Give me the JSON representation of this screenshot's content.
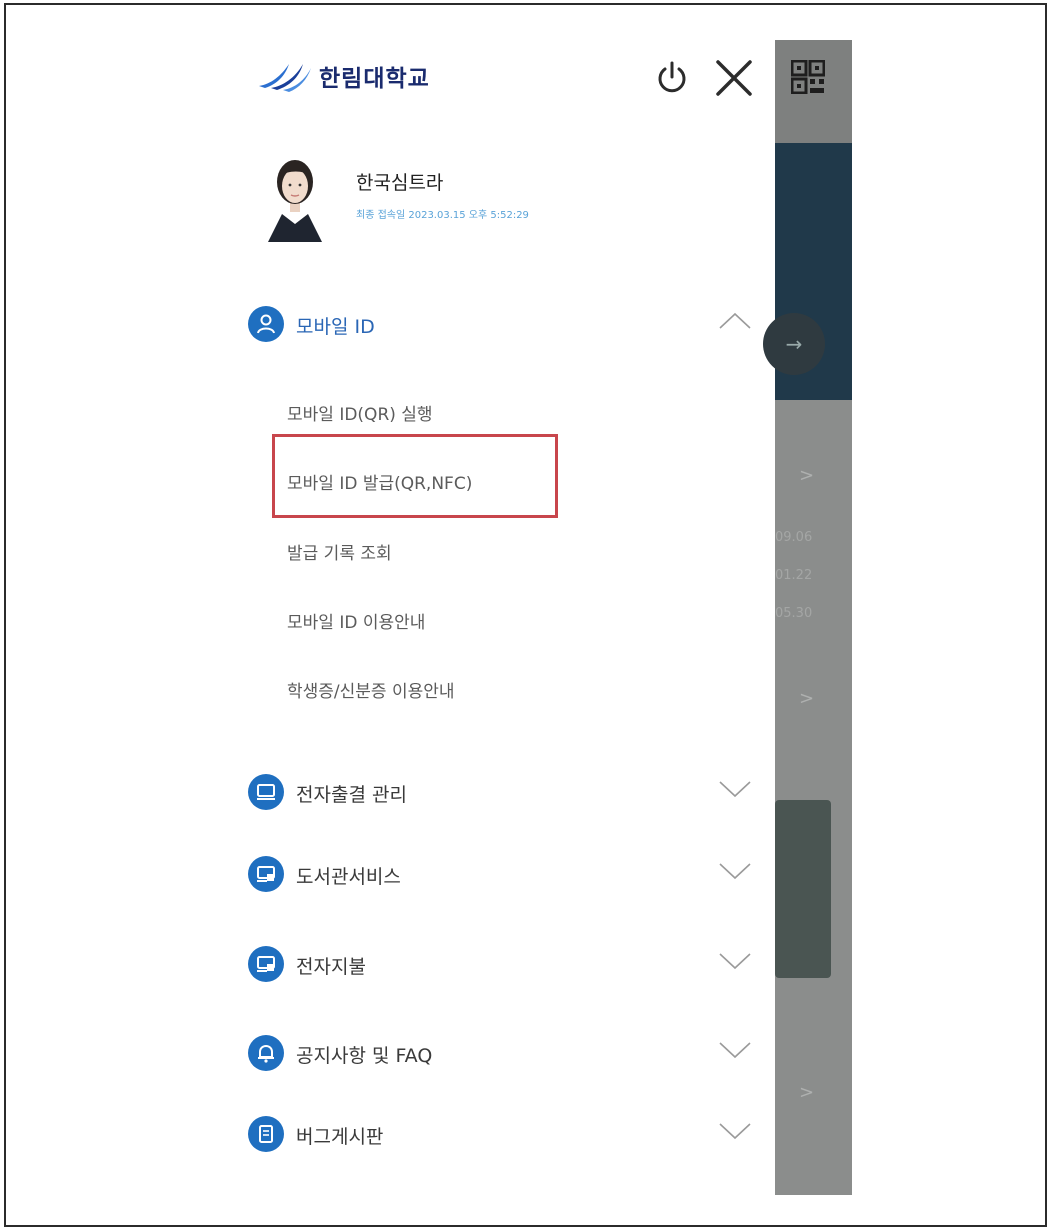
{
  "header": {
    "logo_text": "한림대학교",
    "icons": [
      "power-icon",
      "close-icon",
      "qr-code-icon"
    ]
  },
  "user": {
    "name": "한국심트라",
    "last_login": "최종 접속일 2023.03.15 오후 5:52:29"
  },
  "menu": {
    "sections": [
      {
        "label": "모바일 ID",
        "icon": "person-icon",
        "expanded": true
      },
      {
        "label": "전자출결 관리",
        "icon": "monitor-check-icon",
        "expanded": false
      },
      {
        "label": "도서관서비스",
        "icon": "monitor-book-icon",
        "expanded": false
      },
      {
        "label": "전자지불",
        "icon": "monitor-card-icon",
        "expanded": false
      },
      {
        "label": "공지사항 및 FAQ",
        "icon": "bell-icon",
        "expanded": false
      },
      {
        "label": "버그게시판",
        "icon": "document-icon",
        "expanded": false
      }
    ],
    "mobile_id_items": [
      "모바일 ID(QR) 실행",
      "모바일 ID 발급(QR,NFC)",
      "발급 기록 조회",
      "모바일 ID 이용안내",
      "학생증/신분증 이용안내"
    ],
    "highlighted_item": "모바일 ID 발급(QR,NFC)"
  },
  "background": {
    "dates": [
      "09.06",
      "01.22",
      "05.30"
    ]
  },
  "colors": {
    "accent": "#1f6fc0",
    "highlight_border": "#c8464c",
    "overlay": "#8b8d8c"
  }
}
